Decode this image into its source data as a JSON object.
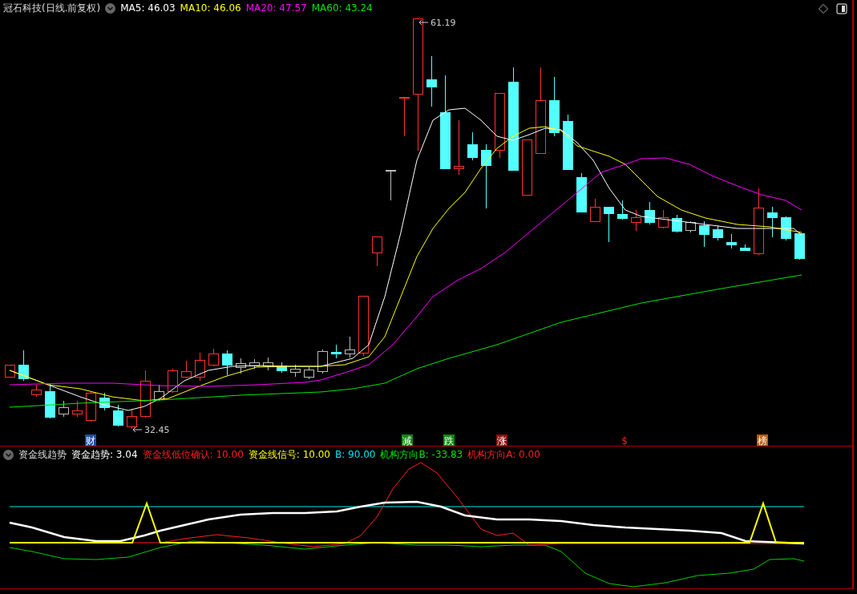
{
  "main_panel": {
    "title": "冠石科技(日线.前复权)",
    "indicators": [
      {
        "text": "MA5: 46.03",
        "color": "#ffffff"
      },
      {
        "text": "MA10: 46.06",
        "color": "#ffff00"
      },
      {
        "text": "MA20: 47.57",
        "color": "#ff00ff"
      },
      {
        "text": "MA60: 43.24",
        "color": "#00e600"
      }
    ],
    "annotations": [
      {
        "text": "61.19",
        "kind": "high"
      },
      {
        "text": "32.45",
        "kind": "low"
      }
    ],
    "markers": [
      {
        "text": "财",
        "color": "#1f4ea8",
        "kind": "boxed"
      },
      {
        "text": "减",
        "color": "#118811",
        "kind": "boxed"
      },
      {
        "text": "跌",
        "color": "#118811",
        "kind": "boxed"
      },
      {
        "text": "涨",
        "color": "#8b1010",
        "kind": "boxed"
      },
      {
        "text": "$",
        "color": "#ff2020",
        "kind": "plain"
      },
      {
        "text": "榜",
        "color": "#b85a10",
        "kind": "boxed"
      }
    ]
  },
  "sub_panel": {
    "title": "资金线趋势",
    "indicators": [
      {
        "text": "资金趋势: 3.04",
        "color": "#ffffff"
      },
      {
        "text": "资金线低位确认: 10.00",
        "color": "#ff2020"
      },
      {
        "text": "资金线信号: 10.00",
        "color": "#ffff00"
      },
      {
        "text": "B: 90.00",
        "color": "#00e5ee"
      },
      {
        "text": "机构方向B: -33.83",
        "color": "#00e600"
      },
      {
        "text": "机构方向A: 0.00",
        "color": "#ff2020"
      }
    ]
  }
}
